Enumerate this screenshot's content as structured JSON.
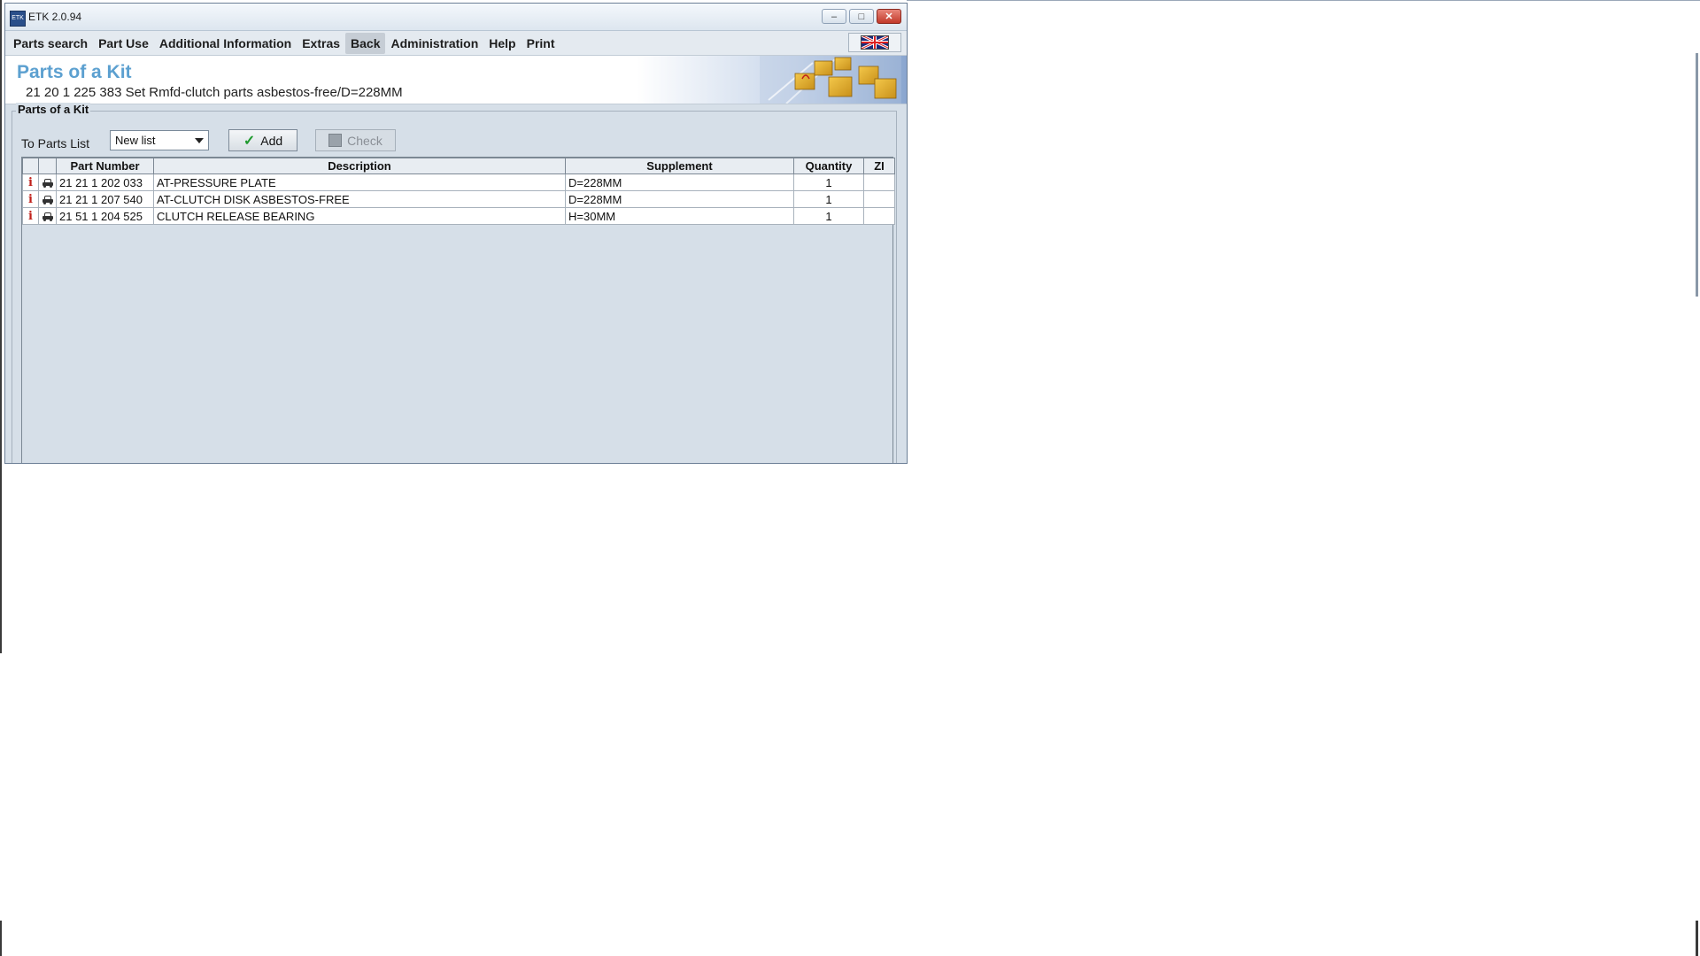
{
  "window": {
    "title": "ETK 2.0.94",
    "app_icon_label": "ETK"
  },
  "menu": {
    "items": [
      {
        "label": "Parts search"
      },
      {
        "label": "Part Use"
      },
      {
        "label": "Additional Information"
      },
      {
        "label": "Extras"
      },
      {
        "label": "Back"
      },
      {
        "label": "Administration"
      },
      {
        "label": "Help"
      },
      {
        "label": "Print"
      }
    ],
    "language_flag": "uk-flag-icon"
  },
  "header": {
    "title": "Parts of a Kit",
    "subtitle": "21 20 1 225 383 Set Rmfd-clutch parts asbestos-free/D=228MM"
  },
  "group": {
    "legend": "Parts of a Kit"
  },
  "toolbar": {
    "to_parts_list_label": "To Parts List",
    "list_select_value": "New list",
    "add_label": "Add",
    "check_label": "Check"
  },
  "table": {
    "headers": [
      "",
      "",
      "Part Number",
      "Description",
      "Supplement",
      "Quantity",
      "ZI"
    ],
    "rows": [
      {
        "part_number": "21 21 1 202 033",
        "description": "AT-PRESSURE PLATE",
        "supplement": "D=228MM",
        "quantity": "1",
        "zi": ""
      },
      {
        "part_number": "21 21 1 207 540",
        "description": "AT-CLUTCH DISK ASBESTOS-FREE",
        "supplement": "D=228MM",
        "quantity": "1",
        "zi": ""
      },
      {
        "part_number": "21 51 1 204 525",
        "description": "CLUTCH RELEASE BEARING",
        "supplement": "H=30MM",
        "quantity": "1",
        "zi": ""
      }
    ]
  },
  "colors": {
    "title_blue": "#5ca0d0",
    "info_red": "#c0201a",
    "check_green": "#1f9a2e",
    "window_bg": "#d6dfe8"
  }
}
